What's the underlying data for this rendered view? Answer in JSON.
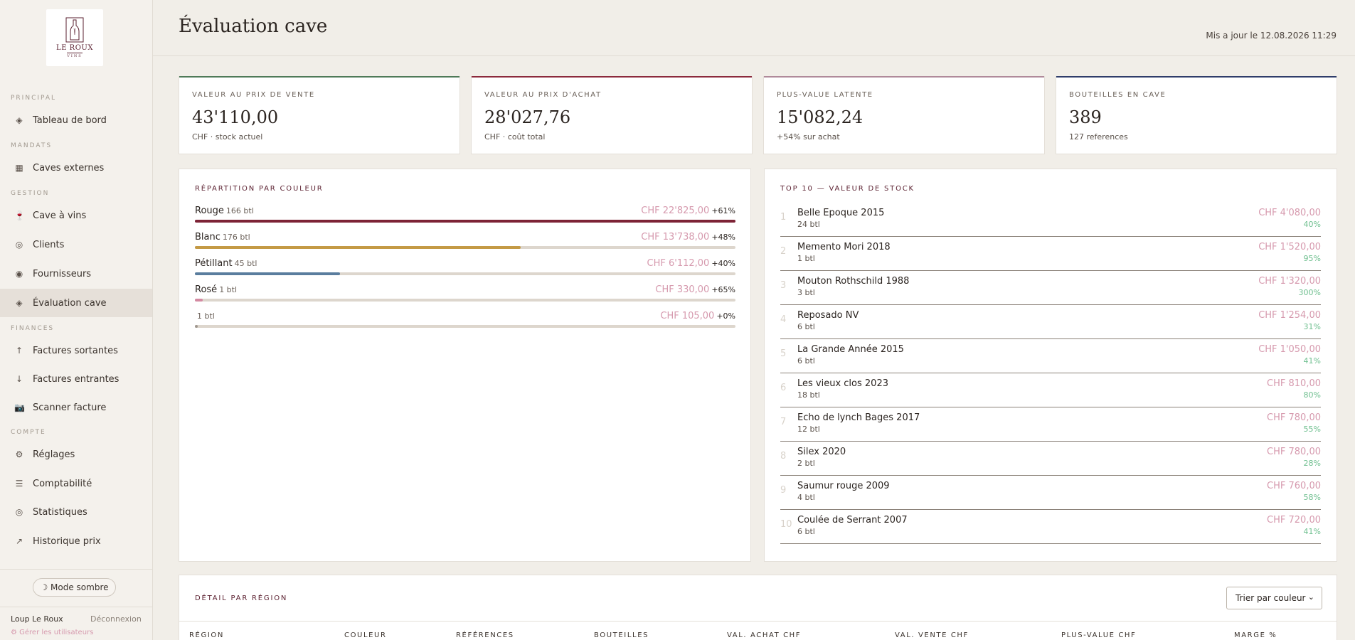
{
  "brand": {
    "logo_name": "LE ROUX",
    "logo_sub": "VINS"
  },
  "sidebar": {
    "sections": [
      {
        "label": "PRINCIPAL",
        "items": [
          {
            "label": "Tableau de bord",
            "icon": "diamond-icon"
          }
        ]
      },
      {
        "label": "MANDATS",
        "items": [
          {
            "label": "Caves externes",
            "icon": "cellar-icon"
          }
        ]
      },
      {
        "label": "GESTION",
        "items": [
          {
            "label": "Cave à vins",
            "icon": "wine-glass-icon"
          },
          {
            "label": "Clients",
            "icon": "circle-icon"
          },
          {
            "label": "Fournisseurs",
            "icon": "dot-circle-icon"
          },
          {
            "label": "Évaluation cave",
            "icon": "diamond-icon",
            "active": true
          }
        ]
      },
      {
        "label": "FINANCES",
        "items": [
          {
            "label": "Factures sortantes",
            "icon": "arrow-up-icon"
          },
          {
            "label": "Factures entrantes",
            "icon": "arrow-down-icon"
          },
          {
            "label": "Scanner facture",
            "icon": "camera-icon"
          }
        ]
      },
      {
        "label": "COMPTE",
        "items": [
          {
            "label": "Réglages",
            "icon": "gear-icon"
          },
          {
            "label": "Comptabilité",
            "icon": "list-icon"
          },
          {
            "label": "Statistiques",
            "icon": "circle-icon"
          },
          {
            "label": "Historique prix",
            "icon": "trend-icon"
          }
        ]
      }
    ],
    "theme_toggle": "☽ Mode sombre",
    "user": "Loup Le Roux",
    "logout": "Déconnexion",
    "manage_users": "⚙ Gérer les utilisateurs"
  },
  "header": {
    "title": "Évaluation cave",
    "updated": "Mis a jour le 12.08.2026 11:29"
  },
  "kpis": [
    {
      "label": "VALEUR AU PRIX DE VENTE",
      "value": "43'110,00",
      "sub": "CHF · stock actuel",
      "accent": "#4f7a58"
    },
    {
      "label": "VALEUR AU PRIX D'ACHAT",
      "value": "28'027,76",
      "sub": "CHF · coût total",
      "accent": "#8c2a3c"
    },
    {
      "label": "PLUS-VALUE LATENTE",
      "value": "15'082,24",
      "sub": "+54% sur achat",
      "accent": "#b08a9a"
    },
    {
      "label": "BOUTEILLES EN CAVE",
      "value": "389",
      "sub": "127 references",
      "accent": "#2f3d6a"
    }
  ],
  "color_split": {
    "title": "RÉPARTITION PAR COULEUR",
    "rows": [
      {
        "name": "Rouge",
        "count": "166 btl",
        "value": "CHF 22'825,00",
        "pct": "+61%",
        "share": 1.0,
        "color": "#7d2336"
      },
      {
        "name": "Blanc",
        "count": "176 btl",
        "value": "CHF 13'738,00",
        "pct": "+48%",
        "share": 0.602,
        "color": "#c49a45"
      },
      {
        "name": "Pétillant",
        "count": "45 btl",
        "value": "CHF 6'112,00",
        "pct": "+40%",
        "share": 0.268,
        "color": "#5a7d9e"
      },
      {
        "name": "Rosé",
        "count": "1 btl",
        "value": "CHF 330,00",
        "pct": "+65%",
        "share": 0.014,
        "color": "#d48aa2"
      },
      {
        "name": "",
        "count": "1 btl",
        "value": "CHF 105,00",
        "pct": "+0%",
        "share": 0.005,
        "color": "#a09890"
      }
    ]
  },
  "top10": {
    "title": "TOP 10 — VALEUR DE STOCK",
    "rows": [
      {
        "rank": "1",
        "name": "Belle Epoque 2015",
        "qty": "24 btl",
        "value": "CHF 4'080,00",
        "pct": "40%"
      },
      {
        "rank": "2",
        "name": "Memento Mori 2018",
        "qty": "1 btl",
        "value": "CHF 1'520,00",
        "pct": "95%"
      },
      {
        "rank": "3",
        "name": "Mouton Rothschild 1988",
        "qty": "3 btl",
        "value": "CHF 1'320,00",
        "pct": "300%"
      },
      {
        "rank": "4",
        "name": "Reposado NV",
        "qty": "6 btl",
        "value": "CHF 1'254,00",
        "pct": "31%"
      },
      {
        "rank": "5",
        "name": "La Grande Année 2015",
        "qty": "6 btl",
        "value": "CHF 1'050,00",
        "pct": "41%"
      },
      {
        "rank": "6",
        "name": "Les vieux clos 2023",
        "qty": "18 btl",
        "value": "CHF 810,00",
        "pct": "80%"
      },
      {
        "rank": "7",
        "name": "Echo de lynch Bages 2017",
        "qty": "12 btl",
        "value": "CHF 780,00",
        "pct": "55%"
      },
      {
        "rank": "8",
        "name": "Silex 2020",
        "qty": "2 btl",
        "value": "CHF 780,00",
        "pct": "28%"
      },
      {
        "rank": "9",
        "name": "Saumur rouge 2009",
        "qty": "4 btl",
        "value": "CHF 760,00",
        "pct": "58%"
      },
      {
        "rank": "10",
        "name": "Coulée de Serrant 2007",
        "qty": "6 btl",
        "value": "CHF 720,00",
        "pct": "41%"
      }
    ]
  },
  "region": {
    "title": "DÉTAIL PAR RÉGION",
    "sort_label": "Trier par couleur",
    "columns": [
      "RÉGION",
      "COULEUR",
      "RÉFÉRENCES",
      "BOUTEILLES",
      "VAL. ACHAT CHF",
      "VAL. VENTE CHF",
      "PLUS-VALUE CHF",
      "MARGE %"
    ]
  }
}
